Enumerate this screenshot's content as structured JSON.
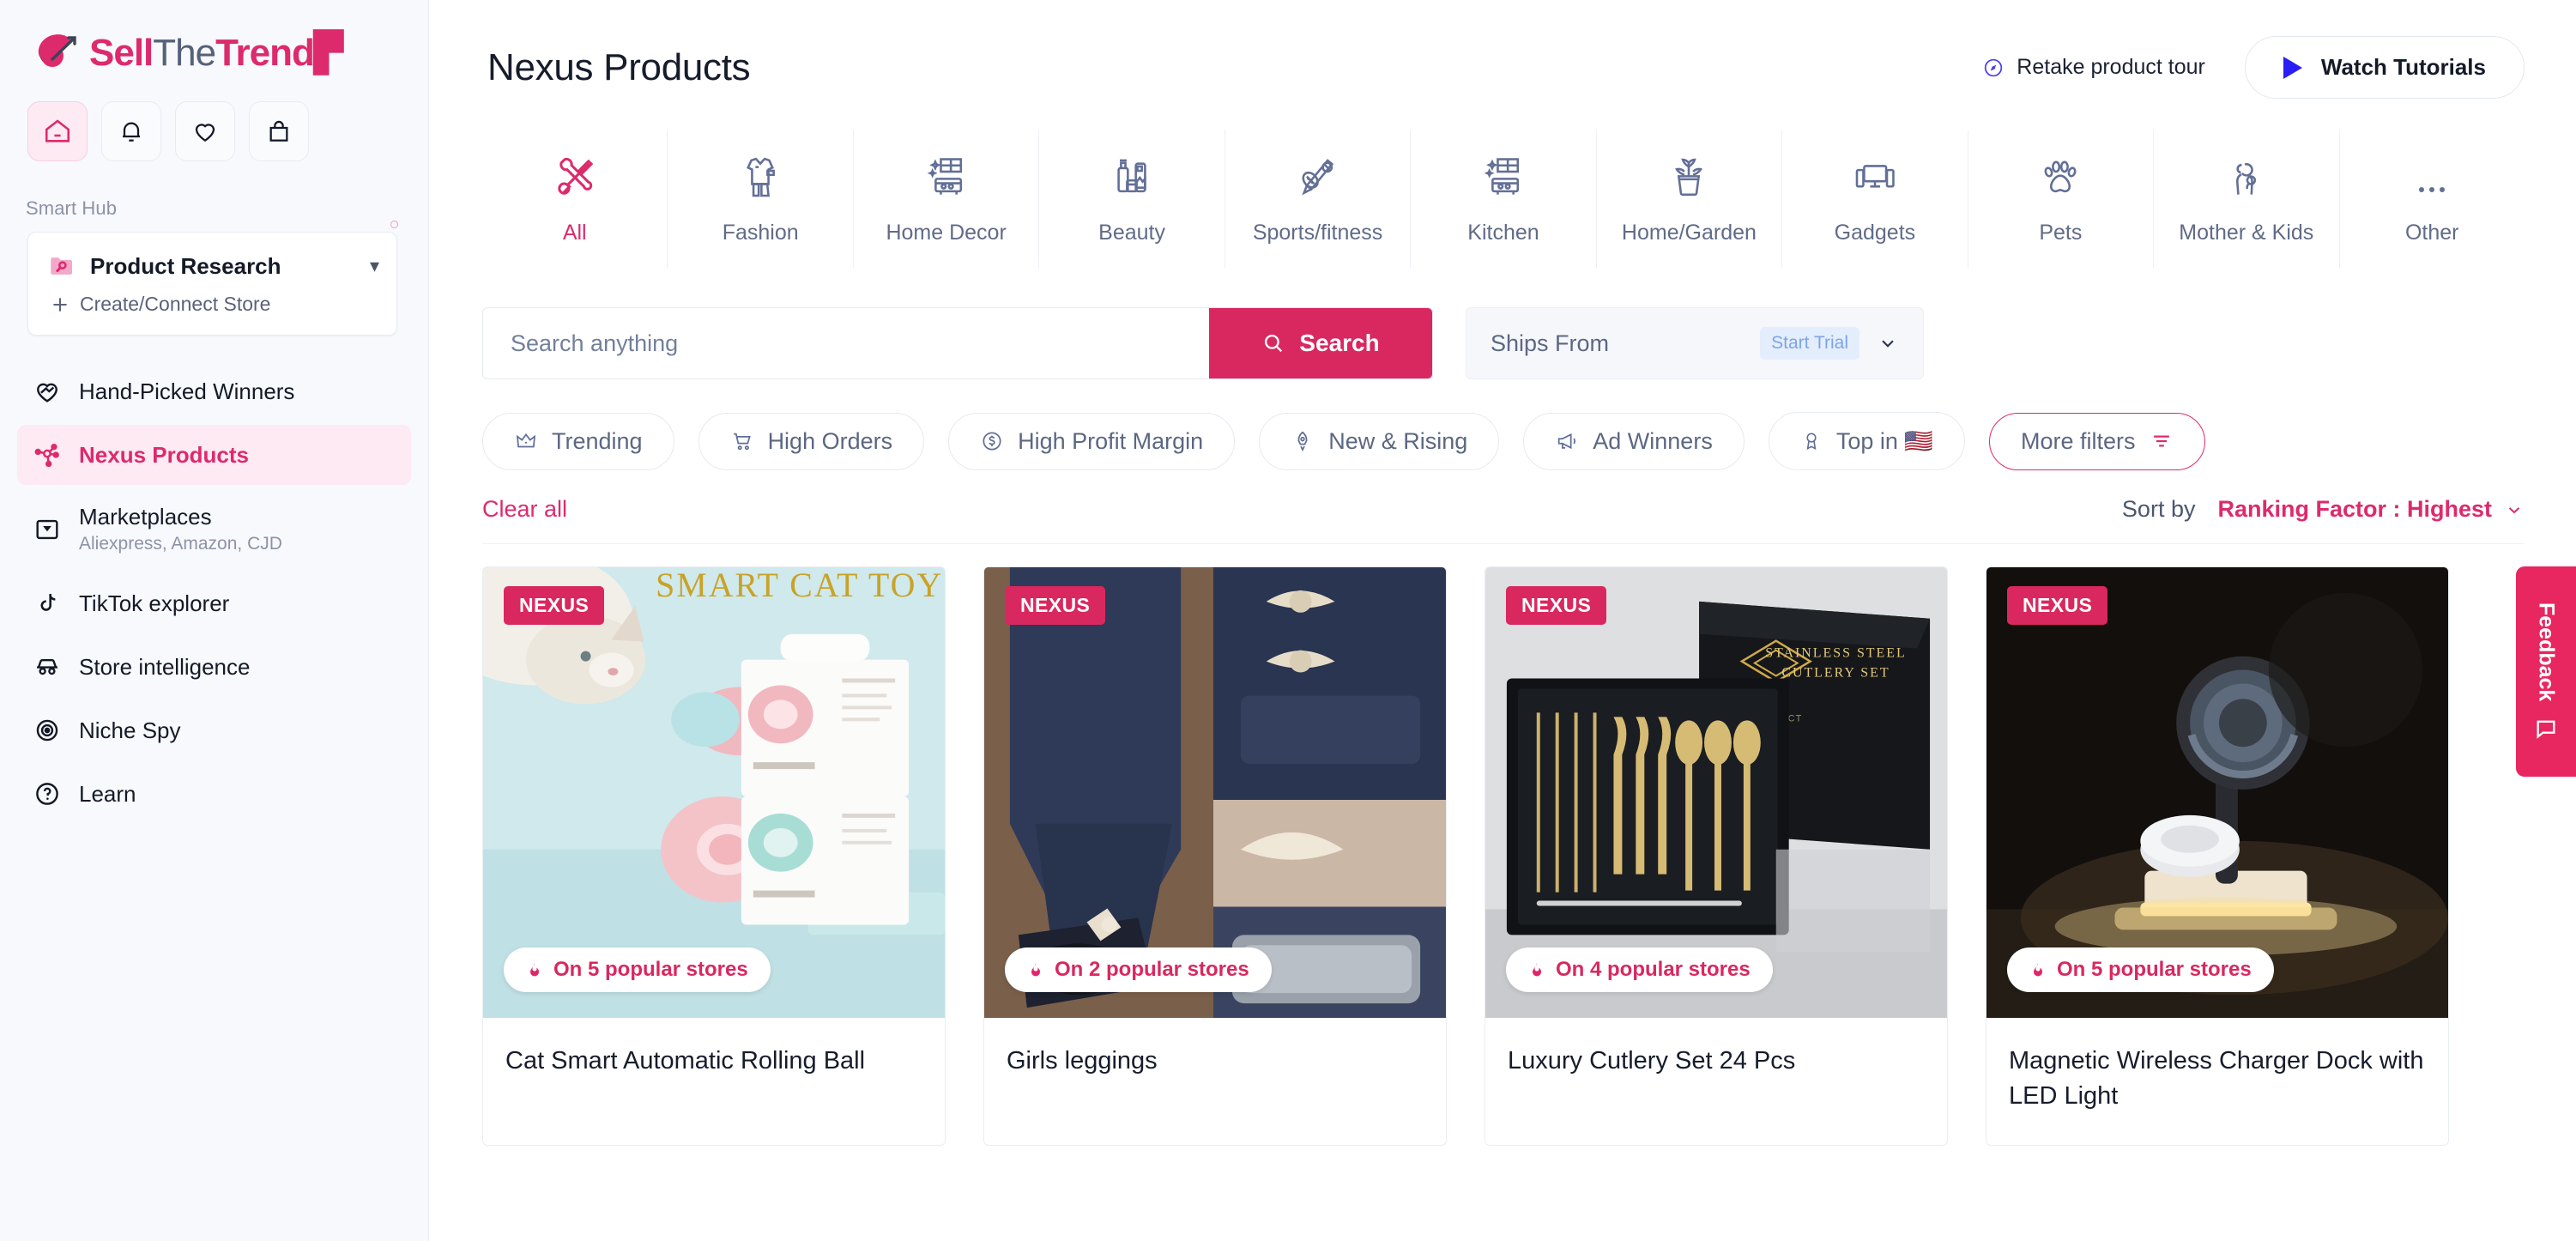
{
  "brand": {
    "name_part1": "Sell",
    "name_part2": "The",
    "name_part3": "Trend",
    "logo_icon": "swoosh-globe-icon"
  },
  "sidebar": {
    "quick_icons": [
      {
        "name": "home-icon",
        "label": "Home",
        "active": true
      },
      {
        "name": "bell-icon",
        "label": "Notifications",
        "active": false
      },
      {
        "name": "heart-icon",
        "label": "Favorites",
        "active": false
      },
      {
        "name": "bag-icon",
        "label": "Bag",
        "active": false
      }
    ],
    "section_label": "Smart Hub",
    "store_card": {
      "icon": "folder-search-icon",
      "name": "Product Research",
      "chevron": "chevron-down-icon",
      "add_icon": "plus-icon",
      "add_label": "Create/Connect Store"
    },
    "items": [
      {
        "icon": "hand-heart-icon",
        "label": "Hand-Picked Winners",
        "sub": "",
        "active": false
      },
      {
        "icon": "nexus-node-icon",
        "label": "Nexus Products",
        "sub": "",
        "active": true
      },
      {
        "icon": "store-icon",
        "label": "Marketplaces",
        "sub": "Aliexpress, Amazon, CJD",
        "active": false
      },
      {
        "icon": "tiktok-icon",
        "label": "TikTok explorer",
        "sub": "",
        "active": false
      },
      {
        "icon": "spy-icon",
        "label": "Store intelligence",
        "sub": "",
        "active": false
      },
      {
        "icon": "target-icon",
        "label": "Niche Spy",
        "sub": "",
        "active": false
      },
      {
        "icon": "question-circle-icon",
        "label": "Learn",
        "sub": "",
        "active": false
      }
    ]
  },
  "header": {
    "title": "Nexus Products",
    "tour_icon": "compass-icon",
    "tour_label": "Retake product tour",
    "watch_icon": "play-icon",
    "watch_label": "Watch Tutorials"
  },
  "categories": [
    {
      "icon": "tools-icon",
      "label": "All",
      "active": true
    },
    {
      "icon": "clothes-icon",
      "label": "Fashion",
      "active": false
    },
    {
      "icon": "furniture-icon",
      "label": "Home Decor",
      "active": false
    },
    {
      "icon": "cosmetics-icon",
      "label": "Beauty",
      "active": false
    },
    {
      "icon": "sports-icon",
      "label": "Sports/fitness",
      "active": false
    },
    {
      "icon": "kitchen-icon",
      "label": "Kitchen",
      "active": false
    },
    {
      "icon": "plant-icon",
      "label": "Home/Garden",
      "active": false
    },
    {
      "icon": "devices-icon",
      "label": "Gadgets",
      "active": false
    },
    {
      "icon": "paw-icon",
      "label": "Pets",
      "active": false
    },
    {
      "icon": "mother-child-icon",
      "label": "Mother & Kids",
      "active": false
    },
    {
      "icon": "ellipsis-icon",
      "label": "Other",
      "active": false
    }
  ],
  "search": {
    "placeholder": "Search anything",
    "value": "",
    "button_icon": "search-icon",
    "button_label": "Search",
    "ships_label": "Ships From",
    "trial_badge": "Start Trial",
    "ships_chevron": "chevron-down-icon"
  },
  "filters": {
    "chips": [
      {
        "icon": "crown-icon",
        "label": "Trending",
        "outlined": false
      },
      {
        "icon": "cart-icon",
        "label": "High Orders",
        "outlined": false
      },
      {
        "icon": "dollar-circle-icon",
        "label": "High Profit Margin",
        "outlined": false
      },
      {
        "icon": "rocket-icon",
        "label": "New & Rising",
        "outlined": false
      },
      {
        "icon": "megaphone-icon",
        "label": "Ad Winners",
        "outlined": false
      },
      {
        "icon": "medal-icon",
        "label": "Top in 🇺🇸",
        "outlined": false
      },
      {
        "icon": "filter-icon",
        "label": "More filters",
        "outlined": true
      }
    ],
    "clear_all": "Clear all",
    "sort_by_label": "Sort by",
    "sort_value": "Ranking Factor : Highest",
    "sort_chevron": "chevron-down-icon"
  },
  "products": [
    {
      "badge": "NEXUS",
      "stores_icon": "flame-icon",
      "stores_label": "On 5 popular stores",
      "title": "Cat Smart Automatic Rolling Ball",
      "image_caption": "SMART CAT TOY",
      "theme": "cat"
    },
    {
      "badge": "NEXUS",
      "stores_icon": "flame-icon",
      "stores_label": "On 2 popular stores",
      "title": "Girls leggings",
      "image_caption": "",
      "theme": "leggings"
    },
    {
      "badge": "NEXUS",
      "stores_icon": "flame-icon",
      "stores_label": "On 4 popular stores",
      "title": "Luxury Cutlery Set 24 Pcs",
      "image_caption": "STAINLESS STEEL CUTLERY SET",
      "theme": "cutlery"
    },
    {
      "badge": "NEXUS",
      "stores_icon": "flame-icon",
      "stores_label": "On 5 popular stores",
      "title": "Magnetic Wireless Charger Dock with LED Light",
      "image_caption": "",
      "theme": "charger"
    }
  ],
  "feedback": {
    "label": "Feedback",
    "icon": "feedback-icon"
  },
  "colors": {
    "accent": "#dd2a6d",
    "accent_strong": "#d9285f",
    "accent_soft": "#fdeaf2",
    "sidebar_bg": "#f7f9fc",
    "text": "#171c2b",
    "muted": "#616b87",
    "border": "#e8ecf3",
    "blue": "#2a1ef5"
  }
}
